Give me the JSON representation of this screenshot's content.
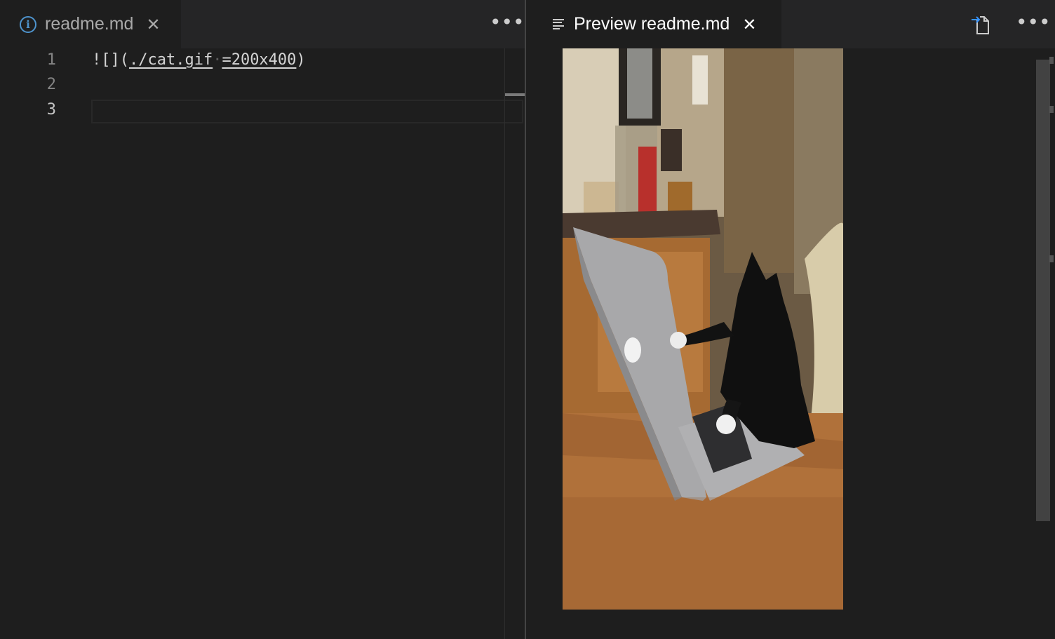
{
  "left_editor": {
    "tab": {
      "icon": "info-icon",
      "label": "readme.md",
      "close_icon": "close-icon"
    },
    "more_actions_icon": "more-icon",
    "line_numbers": [
      "1",
      "2",
      "3"
    ],
    "code_lines": [
      {
        "prefix": "![](",
        "link": "./cat.gif",
        "space_marker": "·",
        "size": "=200x400",
        "suffix": ")"
      },
      {
        "text": ""
      },
      {
        "text": ""
      }
    ],
    "active_line": "3"
  },
  "right_editor": {
    "tab": {
      "icon": "preview-icon",
      "label": "Preview readme.md",
      "close_icon": "close-icon"
    },
    "toolbar_icons": [
      "open-source-icon",
      "more-icon"
    ],
    "preview_image": {
      "depicts": "cat-typing-on-laptop-image"
    }
  },
  "colors": {
    "editor_bg": "#1e1e1e",
    "tabbar_bg": "#252526",
    "info_blue": "#4e94ce",
    "active_tab_text": "#ffffff",
    "inactive_tab_text": "#a8a8a8"
  }
}
